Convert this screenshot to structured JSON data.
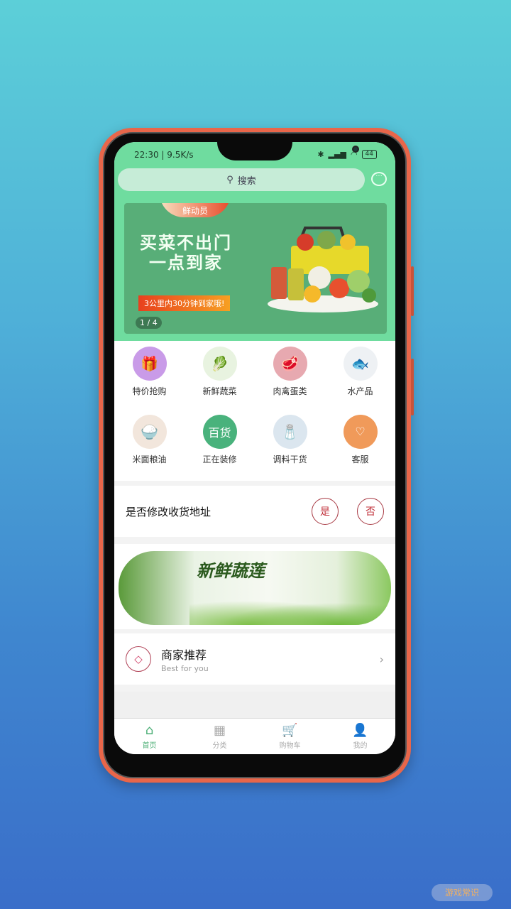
{
  "status_bar": {
    "time_speed": "22:30 | 9.5K/s",
    "icons": [
      "bluetooth-icon",
      "signal-icon",
      "wifi-icon"
    ],
    "battery": "44"
  },
  "search": {
    "placeholder": "搜索"
  },
  "banner": {
    "tag": "鲜动员",
    "title_line1": "买菜不出门",
    "title_line2": "一点到家",
    "subtitle": "3公里内30分钟到家哦!",
    "pager": "1 / 4"
  },
  "categories": [
    {
      "label": "特价抢购",
      "icon": "gift-icon",
      "color": "#c99be8"
    },
    {
      "label": "新鲜蔬菜",
      "icon": "cabbage-icon",
      "color": "#e8f3e0"
    },
    {
      "label": "肉禽蛋类",
      "icon": "meat-icon",
      "color": "#e7a9b0"
    },
    {
      "label": "水产品",
      "icon": "fish-icon",
      "color": "#eef1f4"
    },
    {
      "label": "米面粮油",
      "icon": "rice-icon",
      "color": "#f2e6dc"
    },
    {
      "label": "正在装修",
      "icon": "department-store-icon",
      "color": "#49b27c"
    },
    {
      "label": "调料干货",
      "icon": "seasoning-icon",
      "color": "#dbe6ef"
    },
    {
      "label": "客服",
      "icon": "heart-icon",
      "color": "#f09a5a"
    }
  ],
  "address_prompt": {
    "text": "是否修改收货地址",
    "yes": "是",
    "no": "否"
  },
  "veg_banner": {
    "title": "新鲜蔬莲"
  },
  "merchant": {
    "title": "商家推荐",
    "subtitle": "Best for you"
  },
  "tabs": [
    {
      "label": "首页",
      "icon": "home-icon",
      "active": true
    },
    {
      "label": "分类",
      "icon": "grid-icon",
      "active": false
    },
    {
      "label": "购物车",
      "icon": "cart-icon",
      "active": false
    },
    {
      "label": "我的",
      "icon": "user-icon",
      "active": false
    }
  ],
  "watermark": "游戏常识",
  "colors": {
    "primary": "#6fdc9f",
    "accent_red": "#c0303a",
    "tab_active": "#4caf76"
  }
}
